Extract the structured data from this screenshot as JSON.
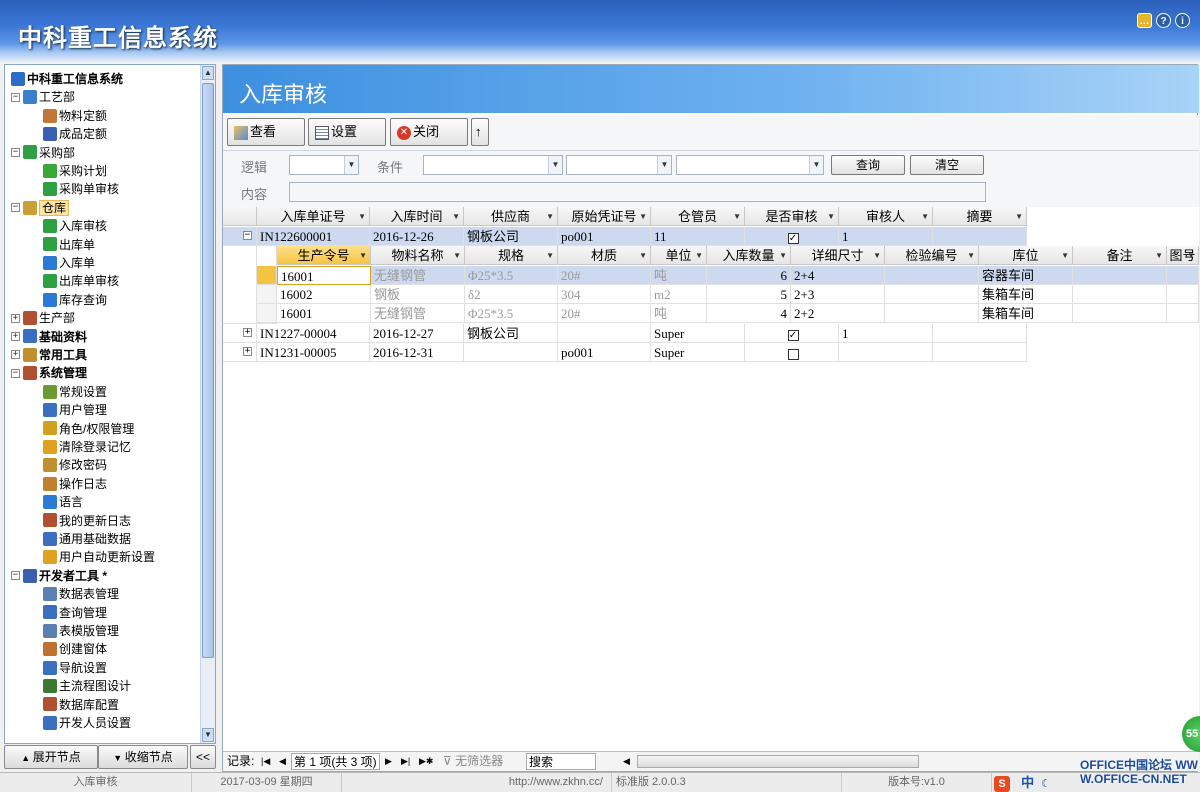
{
  "app": {
    "title": "中科重工信息系统",
    "icons": [
      "chat-icon",
      "help-icon",
      "info-icon"
    ]
  },
  "sidebar": {
    "tree": [
      {
        "label": "中科重工信息系统",
        "level": 0,
        "exp": "",
        "bold": true,
        "icon": "db-icon",
        "color": "#2a6cc7"
      },
      {
        "label": "工艺部",
        "level": 1,
        "exp": "−",
        "icon": "edit-icon",
        "color": "#3a7fd0"
      },
      {
        "label": "物料定额",
        "level": 2,
        "exp": "",
        "icon": "ruler-icon",
        "color": "#c0783a"
      },
      {
        "label": "成品定额",
        "level": 2,
        "exp": "",
        "icon": "chart-icon",
        "color": "#3a5fb0"
      },
      {
        "label": "采购部",
        "level": 1,
        "exp": "−",
        "icon": "plus-icon",
        "color": "#2ea043"
      },
      {
        "label": "采购计划",
        "level": 2,
        "exp": "",
        "icon": "note-icon",
        "color": "#38a838"
      },
      {
        "label": "采购单审核",
        "level": 2,
        "exp": "",
        "icon": "check-icon",
        "color": "#2ea043"
      },
      {
        "label": "仓库",
        "level": 1,
        "exp": "−",
        "icon": "warehouse-icon",
        "color": "#c9a034",
        "selected": true
      },
      {
        "label": "入库审核",
        "level": 2,
        "exp": "",
        "icon": "check-icon",
        "color": "#2ea043"
      },
      {
        "label": "出库单",
        "level": 2,
        "exp": "",
        "icon": "arrow-out-icon",
        "color": "#2ea043"
      },
      {
        "label": "入库单",
        "level": 2,
        "exp": "",
        "icon": "arrow-in-icon",
        "color": "#2a7ad6"
      },
      {
        "label": "出库单审核",
        "level": 2,
        "exp": "",
        "icon": "check-icon",
        "color": "#2ea043"
      },
      {
        "label": "库存查询",
        "level": 2,
        "exp": "",
        "icon": "filter-icon",
        "color": "#2a7ad6"
      },
      {
        "label": "生产部",
        "level": 1,
        "exp": "+",
        "icon": "tools-icon",
        "color": "#b05030"
      },
      {
        "label": "基础资料",
        "level": 1,
        "exp": "+",
        "bold": true,
        "icon": "book-icon",
        "color": "#3a6fc0"
      },
      {
        "label": "常用工具",
        "level": 1,
        "exp": "+",
        "bold": true,
        "icon": "gear-icon",
        "color": "#c09030"
      },
      {
        "label": "系统管理",
        "level": 1,
        "exp": "−",
        "bold": true,
        "icon": "tools-icon",
        "color": "#b05030"
      },
      {
        "label": "常规设置",
        "level": 2,
        "exp": "",
        "icon": "settings-icon",
        "color": "#6a9a30"
      },
      {
        "label": "用户管理",
        "level": 2,
        "exp": "",
        "icon": "user-icon",
        "color": "#3a6fc0"
      },
      {
        "label": "角色/权限管理",
        "level": 2,
        "exp": "",
        "icon": "lock-icon",
        "color": "#d0a020"
      },
      {
        "label": "清除登录记忆",
        "level": 2,
        "exp": "",
        "icon": "folder-icon",
        "color": "#e0a020"
      },
      {
        "label": "修改密码",
        "level": 2,
        "exp": "",
        "icon": "key-icon",
        "color": "#c09030"
      },
      {
        "label": "操作日志",
        "level": 2,
        "exp": "",
        "icon": "magnifier-icon",
        "color": "#c08030"
      },
      {
        "label": "语言",
        "level": 2,
        "exp": "",
        "icon": "info-icon",
        "color": "#2a7ad6"
      },
      {
        "label": "我的更新日志",
        "level": 2,
        "exp": "",
        "icon": "tools-icon",
        "color": "#b05030"
      },
      {
        "label": "通用基础数据",
        "level": 2,
        "exp": "",
        "icon": "tree-icon",
        "color": "#3a6fc0"
      },
      {
        "label": "用户自动更新设置",
        "level": 2,
        "exp": "",
        "icon": "hand-icon",
        "color": "#e0a020"
      },
      {
        "label": "开发者工具  *",
        "level": 1,
        "exp": "−",
        "bold": true,
        "icon": "chart-icon",
        "color": "#3a5fb0"
      },
      {
        "label": "数据表管理",
        "level": 2,
        "exp": "",
        "icon": "table-icon",
        "color": "#5a7fb0"
      },
      {
        "label": "查询管理",
        "level": 2,
        "exp": "",
        "icon": "query-icon",
        "color": "#3a6fc0"
      },
      {
        "label": "表模版管理",
        "level": 2,
        "exp": "",
        "icon": "template-icon",
        "color": "#5a7fb0"
      },
      {
        "label": "创建窗体",
        "level": 2,
        "exp": "",
        "icon": "wand-icon",
        "color": "#c07030"
      },
      {
        "label": "导航设置",
        "level": 2,
        "exp": "",
        "icon": "nav-icon",
        "color": "#3a6fc0"
      },
      {
        "label": "主流程图设计",
        "level": 2,
        "exp": "",
        "icon": "flow-icon",
        "color": "#3a7a30"
      },
      {
        "label": "数据库配置",
        "level": 2,
        "exp": "",
        "icon": "db-icon",
        "color": "#b05030"
      },
      {
        "label": "开发人员设置",
        "level": 2,
        "exp": "",
        "icon": "people-icon",
        "color": "#3a6fc0"
      }
    ],
    "expand_label": "展开节点",
    "collapse_label": "收缩节点",
    "toggle_label": "<<"
  },
  "main": {
    "title": "入库审核",
    "toolbar": {
      "view_label": "查看",
      "settings_label": "设置",
      "close_label": "关闭",
      "up_label": "↑"
    },
    "filter": {
      "logic_label": "逻辑",
      "condition_label": "条件",
      "content_label": "内容",
      "query_label": "查询",
      "clear_label": "清空"
    },
    "grid": {
      "headers": [
        "入库单证号",
        "入库时间",
        "供应商",
        "原始凭证号",
        "仓管员",
        "是否审核",
        "审核人",
        "摘要"
      ],
      "rows": [
        {
          "id": "IN122600001",
          "date": "2016-12-26",
          "supplier": "钢板公司",
          "voucher": "po001",
          "keeper": "11",
          "audited": true,
          "auditor": "1",
          "summary": "",
          "expanded": true
        },
        {
          "id": "IN1227-00004",
          "date": "2016-12-27",
          "supplier": "钢板公司",
          "voucher": "",
          "keeper": "Super",
          "audited": true,
          "auditor": "1",
          "summary": "",
          "expanded": false
        },
        {
          "id": "IN1231-00005",
          "date": "2016-12-31",
          "supplier": "",
          "voucher": "po001",
          "keeper": "Super",
          "audited": false,
          "auditor": "",
          "summary": "",
          "expanded": false
        }
      ],
      "detail_headers": [
        "生产令号",
        "物料名称",
        "规格",
        "材质",
        "单位",
        "入库数量",
        "详细尺寸",
        "检验编号",
        "库位",
        "备注",
        "图号"
      ],
      "detail_rows": [
        {
          "order": "16001",
          "material": "无缝钢管",
          "spec": "Φ25*3.5",
          "grade": "20#",
          "unit": "吨",
          "qty": "6",
          "size": "2+4",
          "inspect": "",
          "location": "容器车间",
          "note": ""
        },
        {
          "order": "16002",
          "material": "钢板",
          "spec": "δ2",
          "grade": "304",
          "unit": "m2",
          "qty": "5",
          "size": "2+3",
          "inspect": "",
          "location": "集箱车间",
          "note": ""
        },
        {
          "order": "16001",
          "material": "无缝钢管",
          "spec": "Φ25*3.5",
          "grade": "20#",
          "unit": "吨",
          "qty": "4",
          "size": "2+2",
          "inspect": "",
          "location": "集箱车间",
          "note": ""
        }
      ]
    },
    "nav": {
      "record_label": "记录:",
      "position_label": "第 1 项(共 3 项)",
      "no_filter_label": "无筛选器",
      "search_label": "搜索"
    }
  },
  "statusbar": {
    "form": "入库审核",
    "date": "2017-03-09 星期四",
    "url": "http://www.zkhn.cc/",
    "edition": "标准版 2.0.0.3",
    "version": "版本号:v1.0",
    "badge": "55",
    "ime": "中"
  },
  "watermark": "OFFICE中国论坛 WWW.OFFICE-CN.NET"
}
